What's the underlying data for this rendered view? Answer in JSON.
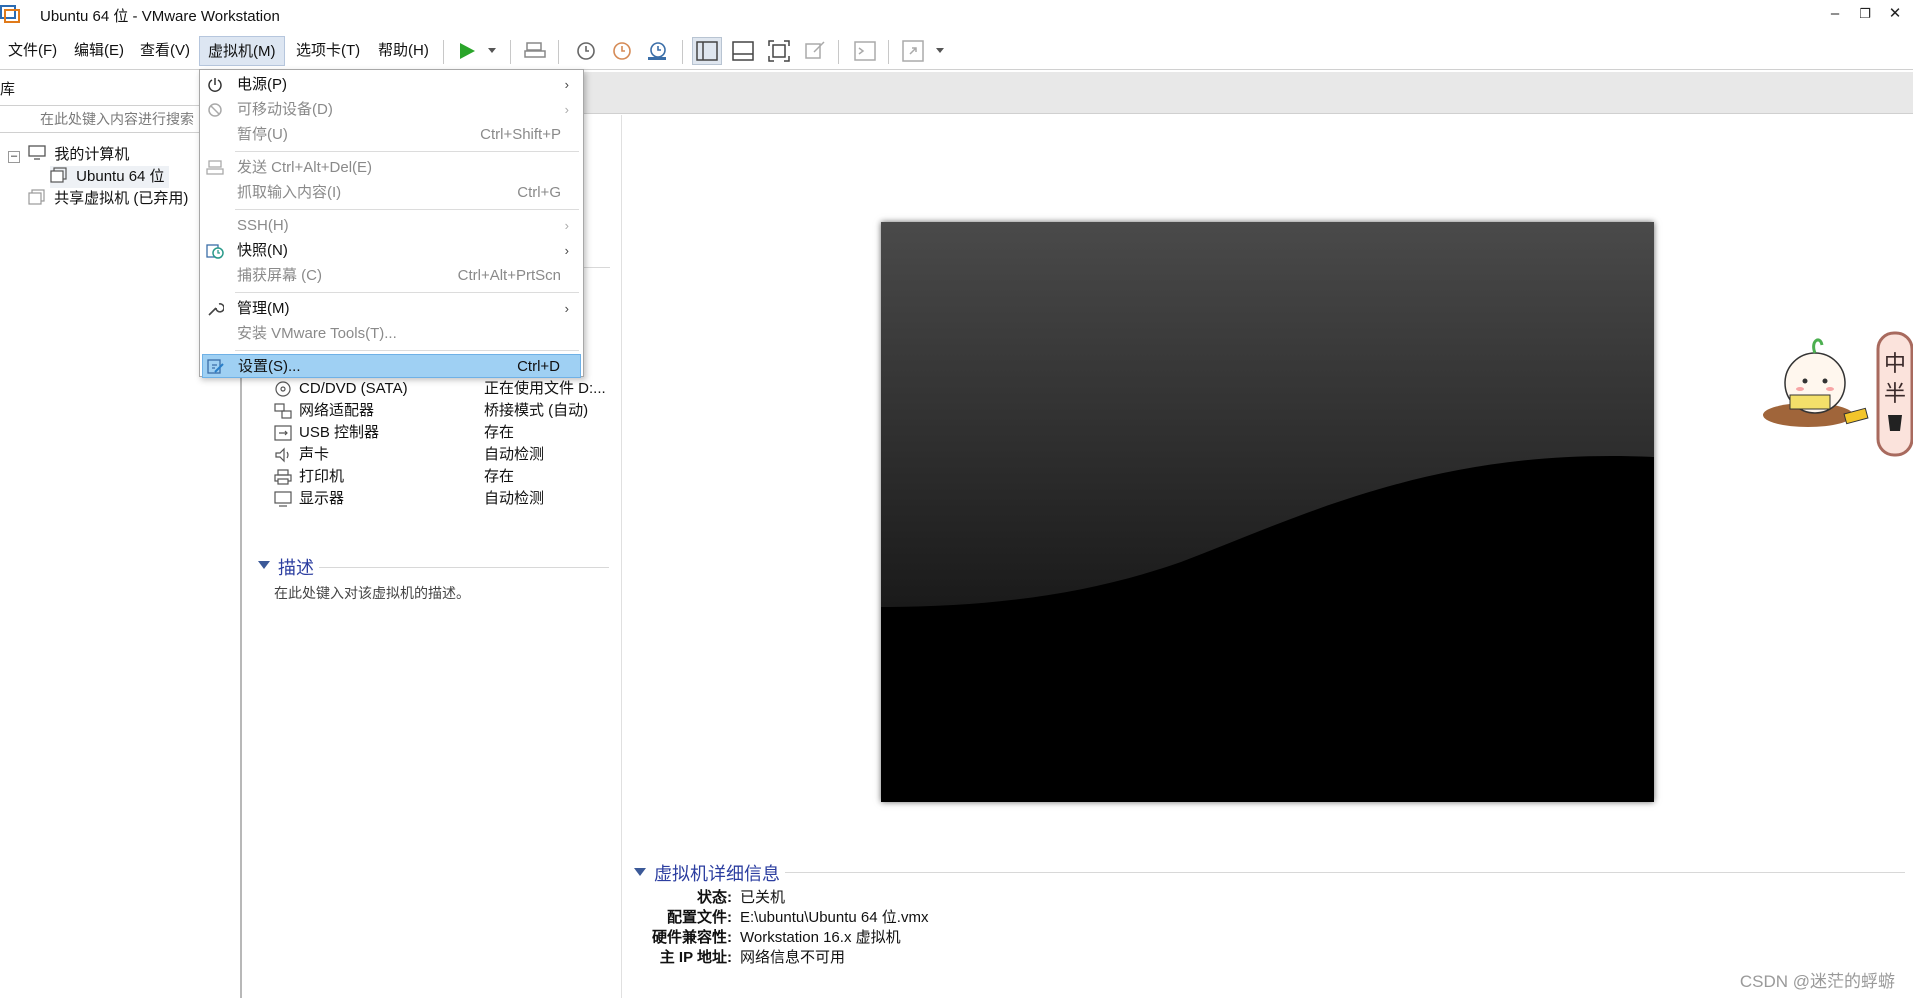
{
  "window": {
    "title": "Ubuntu 64 位 - VMware Workstation",
    "minimize": "–",
    "restore": "❐",
    "close": "✕"
  },
  "menubar": {
    "file": "文件(F)",
    "edit": "编辑(E)",
    "view": "查看(V)",
    "vm": "虚拟机(M)",
    "tabs": "选项卡(T)",
    "help": "帮助(H)"
  },
  "library": {
    "header": "库",
    "search_placeholder": "在此处键入内容进行搜索",
    "tree": {
      "my_computer": "我的计算机",
      "vm_name": "Ubuntu 64 位",
      "shared": "共享虚拟机 (已弃用)"
    }
  },
  "devices": [
    {
      "name": "CD/DVD (SATA)",
      "value": "正在使用文件 D:...",
      "icon": "cd-icon"
    },
    {
      "name": "网络适配器",
      "value": "桥接模式 (自动)",
      "icon": "network-icon"
    },
    {
      "name": "USB 控制器",
      "value": "存在",
      "icon": "usb-icon"
    },
    {
      "name": "声卡",
      "value": "自动检测",
      "icon": "sound-icon"
    },
    {
      "name": "打印机",
      "value": "存在",
      "icon": "printer-icon"
    },
    {
      "name": "显示器",
      "value": "自动检测",
      "icon": "monitor-icon"
    }
  ],
  "description": {
    "title": "描述",
    "placeholder": "在此处键入对该虚拟机的描述。"
  },
  "vm_details": {
    "title": "虚拟机详细信息",
    "rows": [
      {
        "key": "状态:",
        "value": "已关机"
      },
      {
        "key": "配置文件:",
        "value": "E:\\ubuntu\\Ubuntu 64 位.vmx"
      },
      {
        "key": "硬件兼容性:",
        "value": "Workstation 16.x 虚拟机"
      },
      {
        "key": "主 IP 地址:",
        "value": "网络信息不可用"
      }
    ]
  },
  "vm_menu": {
    "power": "电源(P)",
    "removable": "可移动设备(D)",
    "pause": "暂停(U)",
    "pause_shortcut": "Ctrl+Shift+P",
    "send_cad": "发送 Ctrl+Alt+Del(E)",
    "grab_input": "抓取输入内容(I)",
    "grab_shortcut": "Ctrl+G",
    "ssh": "SSH(H)",
    "snapshot": "快照(N)",
    "capture": "捕获屏幕 (C)",
    "capture_shortcut": "Ctrl+Alt+PrtScn",
    "manage": "管理(M)",
    "install_tools": "安装 VMware Tools(T)...",
    "settings": "设置(S)...",
    "settings_shortcut": "Ctrl+D",
    "chevron": "›"
  },
  "watermark": "CSDN @迷茫的蜉蝣",
  "sticker_text": "中半"
}
